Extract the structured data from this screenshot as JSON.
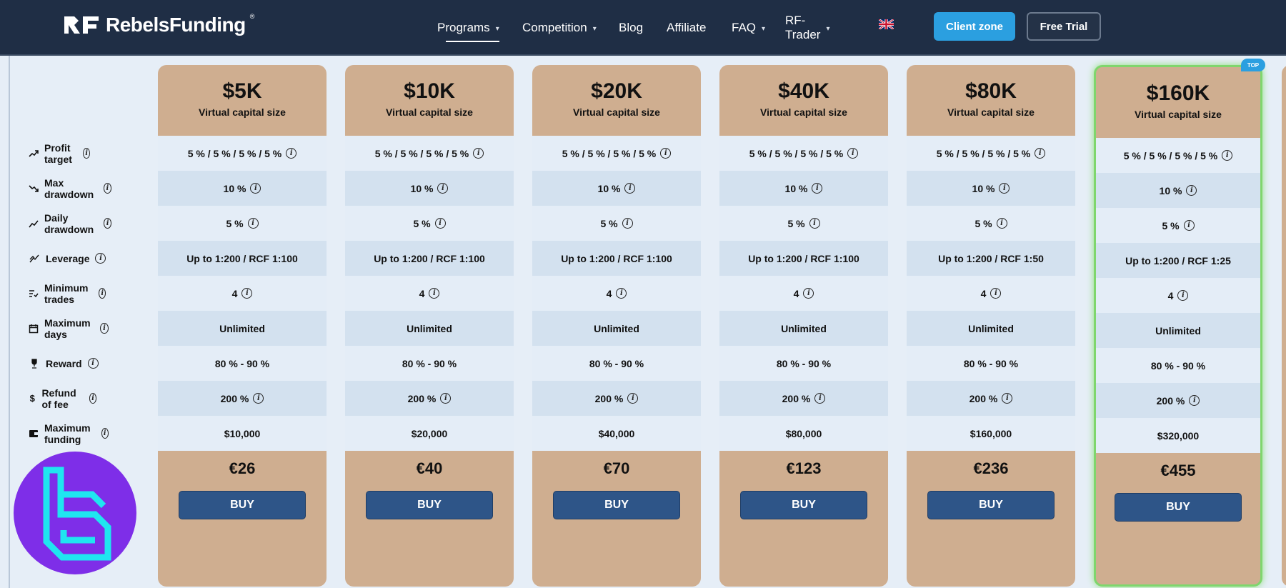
{
  "brand": {
    "name": "RebelsFunding",
    "registered": "®",
    "mark": "RF"
  },
  "nav": {
    "items": [
      {
        "label": "Programs",
        "has_dropdown": true,
        "active": true
      },
      {
        "label": "Competition",
        "has_dropdown": true,
        "active": false
      },
      {
        "label": "Blog",
        "has_dropdown": false,
        "active": false
      },
      {
        "label": "Affiliate",
        "has_dropdown": false,
        "active": false
      },
      {
        "label": "FAQ",
        "has_dropdown": true,
        "active": false
      },
      {
        "label": "RF-Trader",
        "has_dropdown": true,
        "active": false
      }
    ],
    "language_icon": "uk-flag-icon",
    "client_zone_label": "Client zone",
    "free_trial_label": "Free Trial"
  },
  "features": [
    {
      "label": "Profit target",
      "icon": "trend-up-icon"
    },
    {
      "label": "Max drawdown",
      "icon": "trend-down-icon"
    },
    {
      "label": "Daily drawdown",
      "icon": "chart-line-icon"
    },
    {
      "label": "Leverage",
      "icon": "leverage-icon"
    },
    {
      "label": "Minimum trades",
      "icon": "list-check-icon"
    },
    {
      "label": "Maximum days",
      "icon": "calendar-icon"
    },
    {
      "label": "Reward",
      "icon": "trophy-icon"
    },
    {
      "label": "Refund of fee",
      "icon": "dollar-icon"
    },
    {
      "label": "Maximum funding",
      "icon": "wallet-icon"
    }
  ],
  "info_flags": [
    true,
    true,
    true,
    false,
    true,
    false,
    false,
    true,
    false
  ],
  "subtitle": "Virtual capital size",
  "buy_label": "BUY",
  "top_badge": "TOP",
  "plans": [
    {
      "size": "$5K",
      "values": [
        "5 % / 5 % / 5 % / 5 %",
        "10 %",
        "5 %",
        "Up to 1:200 / RCF 1:100",
        "4",
        "Unlimited",
        "80 % - 90 %",
        "200 %",
        "$10,000"
      ],
      "price": "€26",
      "top": false
    },
    {
      "size": "$10K",
      "values": [
        "5 % / 5 % / 5 % / 5 %",
        "10 %",
        "5 %",
        "Up to 1:200 / RCF 1:100",
        "4",
        "Unlimited",
        "80 % - 90 %",
        "200 %",
        "$20,000"
      ],
      "price": "€40",
      "top": false
    },
    {
      "size": "$20K",
      "values": [
        "5 % / 5 % / 5 % / 5 %",
        "10 %",
        "5 %",
        "Up to 1:200 / RCF 1:100",
        "4",
        "Unlimited",
        "80 % - 90 %",
        "200 %",
        "$40,000"
      ],
      "price": "€70",
      "top": false
    },
    {
      "size": "$40K",
      "values": [
        "5 % / 5 % / 5 % / 5 %",
        "10 %",
        "5 %",
        "Up to 1:200 / RCF 1:100",
        "4",
        "Unlimited",
        "80 % - 90 %",
        "200 %",
        "$80,000"
      ],
      "price": "€123",
      "top": false
    },
    {
      "size": "$80K",
      "values": [
        "5 % / 5 % / 5 % / 5 %",
        "10 %",
        "5 %",
        "Up to 1:200 / RCF 1:50",
        "4",
        "Unlimited",
        "80 % - 90 %",
        "200 %",
        "$160,000"
      ],
      "price": "€236",
      "top": false
    },
    {
      "size": "$160K",
      "values": [
        "5 % / 5 % / 5 % / 5 %",
        "10 %",
        "5 %",
        "Up to 1:200 / RCF 1:25",
        "4",
        "Unlimited",
        "80 % - 90 %",
        "200 %",
        "$320,000"
      ],
      "price": "€455",
      "top": true
    }
  ],
  "colors": {
    "navbar": "#1f2e45",
    "card": "#cfae90",
    "row_light": "#e4edf7",
    "row_dark": "#d3e1ef",
    "buy": "#2e5588",
    "client_zone": "#2b9fe0",
    "top_glow": "#7fd66d",
    "watermark": "#7e2ee8"
  }
}
